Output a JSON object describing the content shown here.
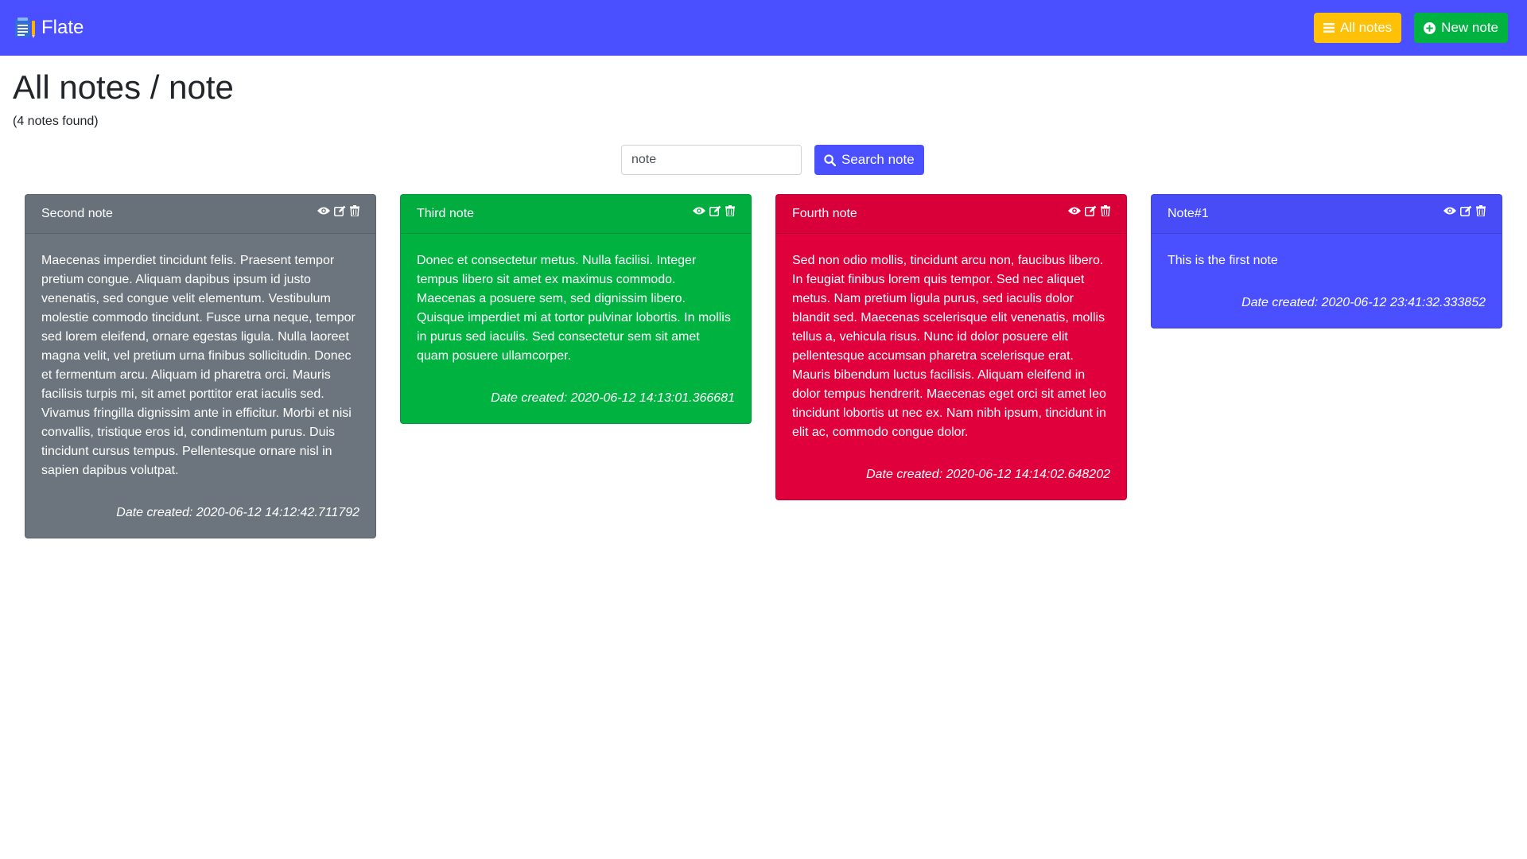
{
  "navbar": {
    "brand": "Flate",
    "all_notes_label": "All notes",
    "new_note_label": "New note",
    "color": "#4a4fff"
  },
  "header": {
    "title": "All notes / note",
    "subtitle": "(4 notes found)"
  },
  "search": {
    "value": "note",
    "button_label": "Search note"
  },
  "notes": [
    {
      "title": "Second note",
      "color": "#6c757d",
      "body": "Maecenas imperdiet tincidunt felis. Praesent tempor pretium congue. Aliquam dapibus ipsum id justo venenatis, sed congue velit elementum. Vestibulum molestie commodo tincidunt. Fusce urna neque, tempor sed lorem eleifend, ornare egestas ligula. Nulla laoreet magna velit, vel pretium urna finibus sollicitudin. Donec et fermentum arcu. Aliquam id pharetra orci. Mauris facilisis turpis mi, sit amet porttitor erat iaculis sed. Vivamus fringilla dignissim ante in efficitur. Morbi et nisi convallis, tristique eros id, condimentum purus. Duis tincidunt cursus tempus. Pellentesque ornare nisl in sapien dapibus volutpat.",
      "date": "Date created: 2020-06-12 14:12:42.711792"
    },
    {
      "title": "Third note",
      "color": "#00b341",
      "body": "Donec et consectetur metus. Nulla facilisi. Integer tempus libero sit amet ex maximus commodo. Maecenas a posuere sem, sed dignissim libero. Quisque imperdiet mi at tortor pulvinar lobortis. In mollis in purus sed iaculis. Sed consectetur sem sit amet quam posuere ullamcorper.",
      "date": "Date created: 2020-06-12 14:13:01.366681"
    },
    {
      "title": "Fourth note",
      "color": "#e0003c",
      "body": "Sed non odio mollis, tincidunt arcu non, faucibus libero. In feugiat finibus lorem quis tempor. Sed nec aliquet metus. Nam pretium ligula purus, sed iaculis dolor blandit sed. Maecenas scelerisque elit venenatis, mollis tellus a, vehicula risus. Nunc id dolor posuere elit pellentesque accumsan pharetra scelerisque erat. Mauris bibendum luctus facilisis. Aliquam eleifend in dolor tempus hendrerit. Maecenas eget orci sit amet leo tincidunt lobortis ut nec ex. Nam nibh ipsum, tincidunt in elit ac, commodo congue dolor.",
      "date": "Date created: 2020-06-12 14:14:02.648202"
    },
    {
      "title": "Note#1",
      "color": "#4a4fff",
      "body": "This is the first note",
      "date": "Date created: 2020-06-12 23:41:32.333852"
    }
  ]
}
